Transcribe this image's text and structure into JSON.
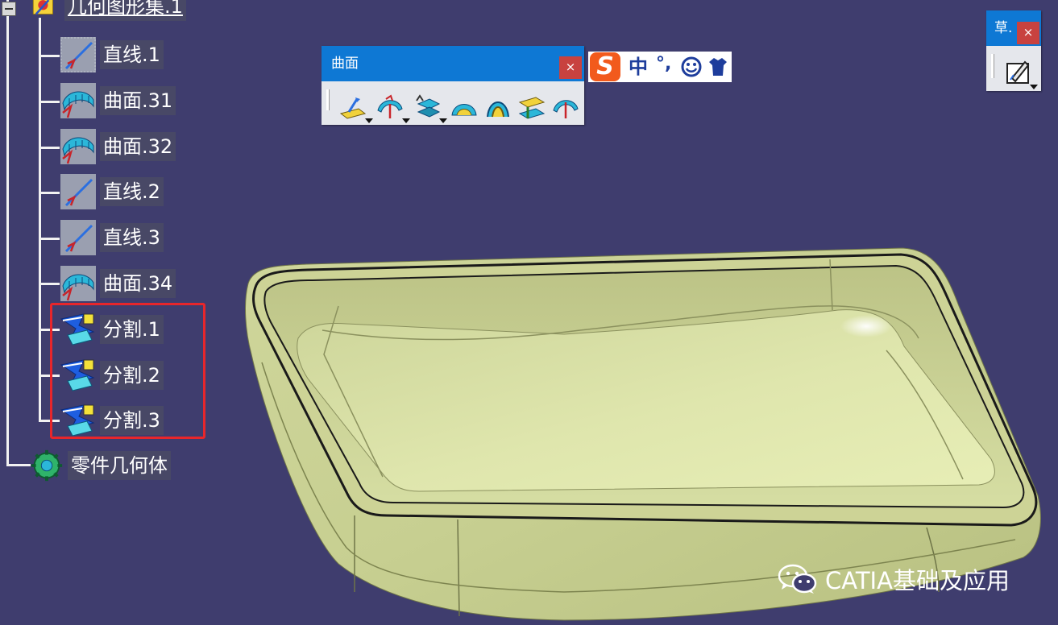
{
  "app": {
    "window_title": "CATIA"
  },
  "tree": {
    "root": {
      "label": "几何图形集.1",
      "icon": "geometrical-set-icon"
    },
    "items": [
      {
        "label": "直线.1",
        "icon": "line-icon"
      },
      {
        "label": "曲面.31",
        "icon": "surface-icon"
      },
      {
        "label": "曲面.32",
        "icon": "surface-icon"
      },
      {
        "label": "直线.2",
        "icon": "line-icon"
      },
      {
        "label": "直线.3",
        "icon": "line-icon"
      },
      {
        "label": "曲面.34",
        "icon": "surface-icon"
      },
      {
        "label": "分割.1",
        "icon": "split-icon"
      },
      {
        "label": "分割.2",
        "icon": "split-icon"
      },
      {
        "label": "分割.3",
        "icon": "split-icon"
      }
    ],
    "body": {
      "label": "零件几何体",
      "icon": "part-body-icon"
    }
  },
  "surfaces_toolbar": {
    "title": "曲面",
    "close_label": "×",
    "tools": [
      "extrude-icon",
      "revolve-icon",
      "offset-icon",
      "fill-icon",
      "multi-section-icon",
      "blend-icon",
      "sweep-icon"
    ]
  },
  "sketch_toolbar": {
    "title": "草.",
    "close_label": "×",
    "tools": [
      "sketch-icon"
    ]
  },
  "ime": {
    "logo_label": "S",
    "mode_label": "中",
    "punct_label": "°,",
    "icons": [
      "sogou-logo-icon",
      "emoji-icon",
      "skin-shirt-icon"
    ]
  },
  "watermark": {
    "text": "CATIA基础及应用",
    "icon": "wechat-icon"
  },
  "colors": {
    "background": "#3f3d6e",
    "model": "#d4dda0",
    "toolbar_title": "#0e78d4",
    "close": "#c8423f",
    "highlight": "#e8262b"
  }
}
